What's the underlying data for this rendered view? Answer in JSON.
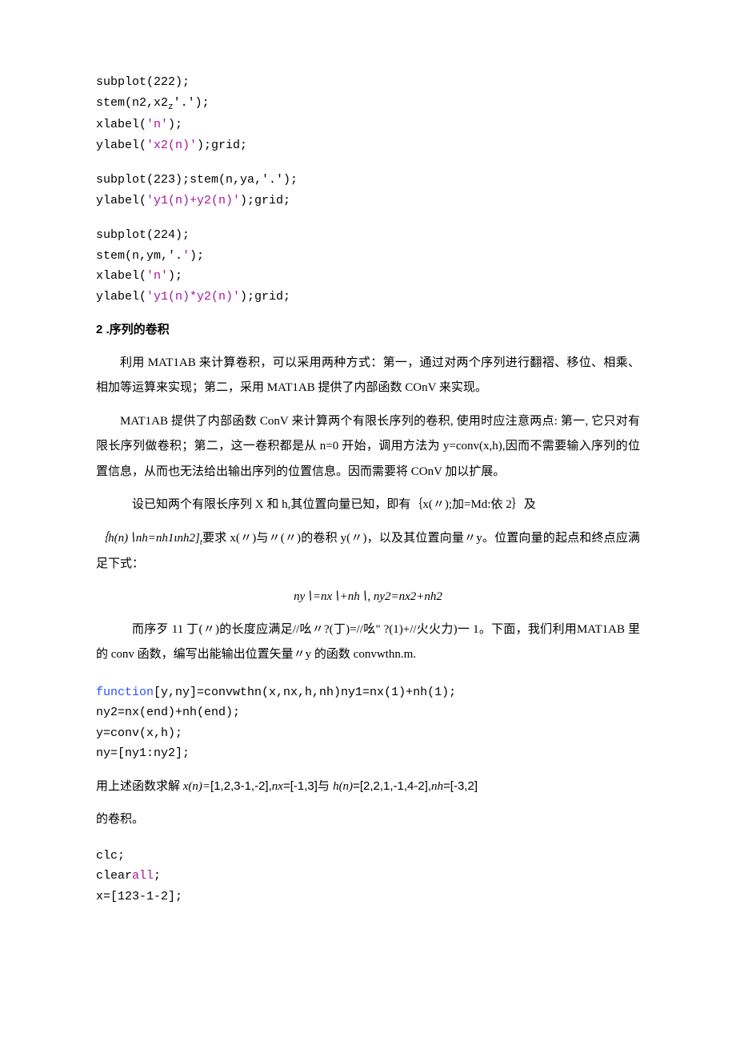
{
  "code1": {
    "l1": "subplot(222);",
    "l2a": "stem(n2,x2",
    "l2b": "z",
    "l2c": "'.');",
    "l3a": "xlabel(",
    "l3b": "'n'",
    "l3c": ");",
    "l4a": "ylabel(",
    "l4b": "'x2(n)'",
    "l4c": ");grid;"
  },
  "code2": {
    "l1": "subplot(223);stem(n,ya,'.');",
    "l2a": "ylabel(",
    "l2b": "'y1(n)+y2(n)'",
    "l2c": ");grid;"
  },
  "code3": {
    "l1": "subplot(224);",
    "l2a": "stem(n,ym,'.",
    "l2b": "'",
    "l2c": ");",
    "l3a": "xlabel(",
    "l3b": "'n'",
    "l3c": ");",
    "l4a": "ylabel(",
    "l4b": "'y1(n)*y2(n)'",
    "l4c": ");grid;"
  },
  "heading": "2 .序列的卷积",
  "p1": "利用 MAT1AB 来计算卷积，可以采用两种方式：第一，通过对两个序列进行翻褶、移位、相乘、相加等运算来实现；第二，采用 MAT1AB 提供了内部函数 COnV 来实现。",
  "p2": "MAT1AB 提供了内部函数 ConV 来计算两个有限长序列的卷积, 使用时应注意两点: 第一, 它只对有限长序列做卷积；第二，这一卷积都是从 n=0 开始，调用方法为 y=conv(x,h),因而不需要输入序列的位置信息，从而也无法给出输出序列的位置信息。因而需要将 COnV 加以扩展。",
  "p3": "设已知两个有限长序列 X 和 h,其位置向量已知，即有｛x(〃);加=Md:依 2｝及",
  "p4a": "｛h(n)∖nh=nh1ιnh2]",
  "p4b": "t",
  "p4c": "要求 x(〃)与〃(〃)的卷积 y(〃)，以及其位置向量〃y。位置向量的起点和终点应满足下式：",
  "formula": "ny∖=nx∖+nh∖, ny2=nx2+nh2",
  "p5": "而序歹 11 丁(〃)的长度应满足//吆〃?(丁)=//吆\" ?(1)+//火火力)一 1。下面，我们利用MAT1AB 里的 conv 函数，编写出能输出位置矢量〃y 的函数 convwthn.m.",
  "code4": {
    "kw": "function",
    "l1b": "[y,ny]=convwthn(x,nx,h,nh)ny1=nx(1)+nh(1);",
    "l2": "ny2=nx(end)+nh(end);",
    "l3": "y=conv(x,h);",
    "l4": "ny=[ny1:ny2];"
  },
  "p6a": "用上述函数求解 ",
  "p6b": "x(n)=",
  "p6c": "[1,2,3-1,-2],",
  "p6d": "nx",
  "p6e": "=[-1,3]与 ",
  "p6f": "h(n)",
  "p6g": "=[2,2,1,-1,4-2],",
  "p6h": "nh",
  "p6i": "=[-3,2]",
  "p7": "的卷积。",
  "code5": {
    "l1": "clc;",
    "l2a": "clear",
    "l2b": "all",
    "l2c": ";",
    "l3": "x=[123-1-2];"
  }
}
